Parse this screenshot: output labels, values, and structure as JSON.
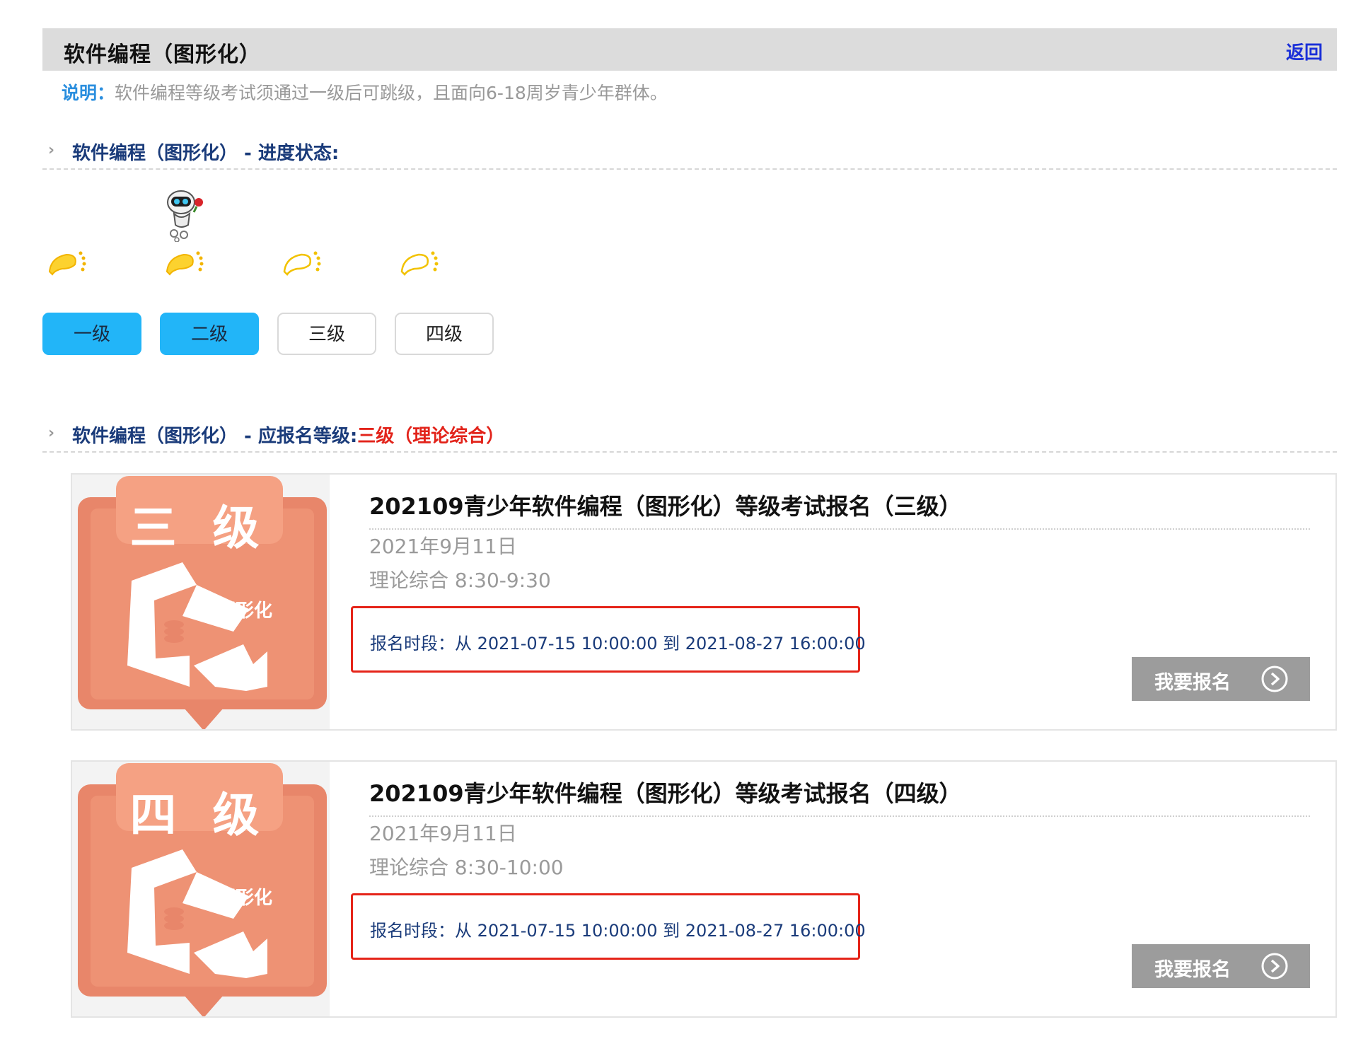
{
  "header": {
    "title": "软件编程（图形化）",
    "back_label": "返回"
  },
  "description": {
    "label": "说明：",
    "text": "软件编程等级考试须通过一级后可跳级，且面向6-18周岁青少年群体。"
  },
  "progress_section": {
    "chevron": "›",
    "title": "软件编程（图形化）  - 进度状态:"
  },
  "levels": [
    {
      "label": "一级",
      "completed": true
    },
    {
      "label": "二级",
      "completed": true
    },
    {
      "label": "三级",
      "completed": false
    },
    {
      "label": "四级",
      "completed": false
    }
  ],
  "apply_section": {
    "chevron": "›",
    "title": "软件编程（图形化）  - 应报名等级:",
    "level": "三级（理论综合）"
  },
  "exams": [
    {
      "badge": "三 级",
      "brand": "图形化",
      "title": "202109青少年软件编程（图形化）等级考试报名（三级）",
      "date": "2021年9月11日",
      "session": "理论综合 8:30-9:30",
      "period": "报名时段：从 2021-07-15 10:00:00 到 2021-08-27 16:00:00",
      "signup_label": "我要报名"
    },
    {
      "badge": "四 级",
      "brand": "图形化",
      "title": "202109青少年软件编程（图形化）等级考试报名（四级）",
      "date": "2021年9月11日",
      "session": "理论综合 8:30-10:00",
      "period": "报名时段：从 2021-07-15 10:00:00 到 2021-08-27 16:00:00",
      "signup_label": "我要报名"
    }
  ],
  "colors": {
    "accent_blue": "#22b5f8",
    "link_blue": "#1a2fd8",
    "badge_orange": "#e8866a",
    "highlight_red": "#e52419",
    "button_gray": "#9c9c9c"
  },
  "icons": [
    "robot-mascot-icon",
    "footprint-icon",
    "chevron-right-icon",
    "play-circle-icon",
    "graphic-programming-logo"
  ]
}
